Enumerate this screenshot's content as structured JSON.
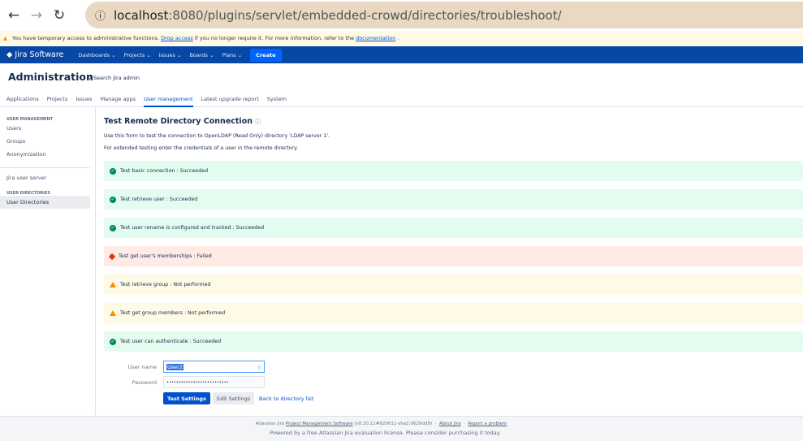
{
  "browser": {
    "url_host": "localhost",
    "url_rest": ":8080/plugins/servlet/embedded-crowd/directories/troubleshoot/"
  },
  "banner": {
    "text1": "You have temporary access to administrative functions.",
    "link1": "Drop access",
    "text2": "if you no longer require it. For more information, refer to the",
    "link2": "documentation",
    "end": "."
  },
  "nav": {
    "logo": "Jira Software",
    "items": [
      "Dashboards",
      "Projects",
      "Issues",
      "Boards",
      "Plans"
    ],
    "create": "Create"
  },
  "header": {
    "title": "Administration",
    "search": "Search Jira admin"
  },
  "tabs": [
    "Applications",
    "Projects",
    "Issues",
    "Manage apps",
    "User management",
    "Latest upgrade report",
    "System"
  ],
  "sidebar": {
    "section1": "USER MANAGEMENT",
    "items1": [
      "Users",
      "Groups",
      "Anonymization"
    ],
    "item2": "Jira user server",
    "section2": "USER DIRECTORIES",
    "items2": [
      "User Directories"
    ]
  },
  "main": {
    "title": "Test Remote Directory Connection",
    "desc1": "Use this form to test the connection to OpenLDAP (Read Only) directory 'LDAP server 1'.",
    "desc2": "For extended testing enter the credentials of a user in the remote directory.",
    "results": [
      {
        "text": "Test basic connection : Succeeded",
        "status": "ok"
      },
      {
        "text": "Test retrieve user : Succeeded",
        "status": "ok"
      },
      {
        "text": "Test user rename is configured and tracked : Succeeded",
        "status": "ok"
      },
      {
        "text": "Test get user's memberships : Failed",
        "status": "fail"
      },
      {
        "text": "Test retrieve group : Not performed",
        "status": "warn"
      },
      {
        "text": "Test get group members : Not performed",
        "status": "warn"
      },
      {
        "text": "Test user can authenticate : Succeeded",
        "status": "ok"
      }
    ],
    "form": {
      "username_label": "User name",
      "username_value": "User2",
      "password_label": "Password",
      "password_value": "••••••••••••••••••••••••••",
      "test": "Test Settings",
      "edit": "Edit Settings",
      "back": "Back to directory list"
    }
  },
  "footer": {
    "t1": "Atlassian Jira",
    "l1": "Project Management Software",
    "t2": "(v8.20.11#820011-sha1:0629dd8)",
    "l2": "About Jira",
    "l3": "Report a problem",
    "line2": "Powered by a free Atlassian Jira evaluation license. Please consider purchasing it today."
  }
}
